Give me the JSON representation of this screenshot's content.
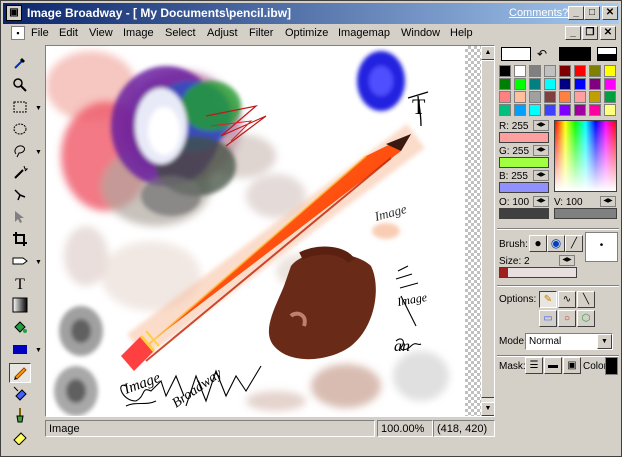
{
  "window": {
    "title": "Image Broadway - [ My Documents\\pencil.ibw]",
    "comments_link": "Comments?",
    "min_glyph": "_",
    "max_glyph": "□",
    "close_glyph": "✕",
    "restore_glyph": "❐"
  },
  "menu": [
    "File",
    "Edit",
    "View",
    "Image",
    "Select",
    "Adjust",
    "Filter",
    "Optimize",
    "Imagemap",
    "Window",
    "Help"
  ],
  "status": {
    "text": "Image",
    "zoom": "100.00%",
    "coords": "(418, 420)"
  },
  "canvas": {
    "text_t": "T",
    "text_image1": "Image",
    "text_image2": "Image",
    "text_image3": "Image",
    "text_an": "an",
    "text_broadway": "Broadway"
  },
  "colors": {
    "foreground": "#ffffff",
    "background": "#000000",
    "palette": [
      "#000000",
      "#ffffff",
      "#808080",
      "#c0c0c0",
      "#800000",
      "#ff0000",
      "#808000",
      "#ffff00",
      "#008000",
      "#00ff00",
      "#008080",
      "#00ffff",
      "#000080",
      "#0000ff",
      "#800080",
      "#ff00ff",
      "#ff8080",
      "#ffc0a0",
      "#a0a0a0",
      "#804040",
      "#ff8040",
      "#ffa0a0",
      "#c0a000",
      "#00a040",
      "#00c080",
      "#00a0ff",
      "#00ffff",
      "#4040ff",
      "#8000ff",
      "#a000a0",
      "#ff00a0",
      "#ffff80"
    ]
  },
  "sliders": {
    "r_label": "R: 255",
    "g_label": "G: 255",
    "b_label": "B: 255",
    "o_label": "O: 100",
    "v_label": "V: 100",
    "r_color": "#ffa0a0",
    "g_color": "#a0ff40",
    "b_color": "#9090ff"
  },
  "brush": {
    "label": "Brush:",
    "size_label": "Size: 2"
  },
  "options": {
    "label": "Options:",
    "mode_label": "Mode:",
    "mode_value": "Normal",
    "mask_label": "Mask:",
    "color_label": "Color:"
  }
}
